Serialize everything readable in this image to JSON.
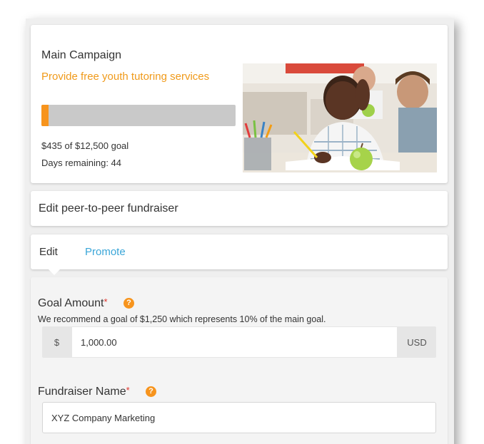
{
  "campaign": {
    "title": "Main Campaign",
    "subtitle": "Provide free youth tutoring services",
    "progress_fraction": 0.035,
    "goal_text": "$435 of $12,500 goal",
    "days_remaining": "Days remaining: 44",
    "accent_color": "#f7941d"
  },
  "peer": {
    "title": "Edit peer-to-peer fundraiser"
  },
  "tabs": [
    {
      "label": "Edit",
      "active": true
    },
    {
      "label": "Promote",
      "active": false
    }
  ],
  "form": {
    "goal": {
      "label": "Goal Amount",
      "required_mark": "*",
      "help_icon": "?",
      "recommendation": "We recommend a goal of $1,250 which represents 10% of the main goal.",
      "currency_symbol": "$",
      "value": "1,000.00",
      "currency": "USD"
    },
    "name": {
      "label": "Fundraiser Name",
      "required_mark": "*",
      "help_icon": "?",
      "value": "XYZ Company Marketing"
    }
  }
}
